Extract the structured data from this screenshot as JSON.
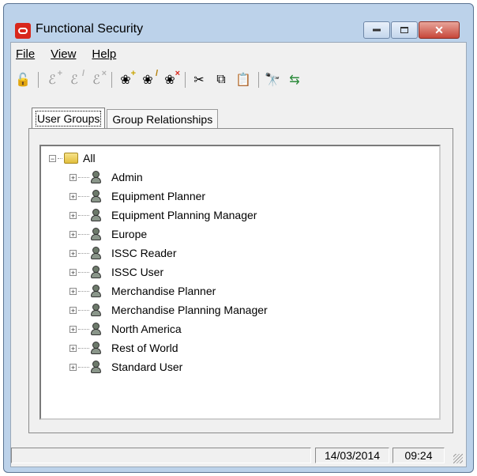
{
  "window": {
    "title": "Functional Security"
  },
  "menu": {
    "file": "File",
    "view": "View",
    "help": "Help"
  },
  "toolbar": {
    "icons": [
      "connect-icon",
      "add-user-icon",
      "edit-user-icon",
      "delete-user-icon",
      "add-group-icon",
      "edit-group-icon",
      "delete-group-icon",
      "cut-icon",
      "copy-icon",
      "paste-icon",
      "find-icon",
      "refresh-icon"
    ]
  },
  "tabs": [
    {
      "label": "User Groups",
      "active": true
    },
    {
      "label": "Group Relationships",
      "active": false
    }
  ],
  "tree": {
    "root": "All",
    "items": [
      "Admin",
      "Equipment Planner",
      "Equipment Planning Manager",
      "Europe",
      "ISSC Reader",
      "ISSC User",
      "Merchandise Planner",
      "Merchandise Planning Manager",
      "North America",
      "Rest of World",
      "Standard User"
    ]
  },
  "status": {
    "main": "",
    "date": "14/03/2014",
    "time": "09:24"
  },
  "colors": {
    "titlebar": "#bcd2ea",
    "close_button": "#c7473a",
    "oracle_red": "#d8271c"
  }
}
